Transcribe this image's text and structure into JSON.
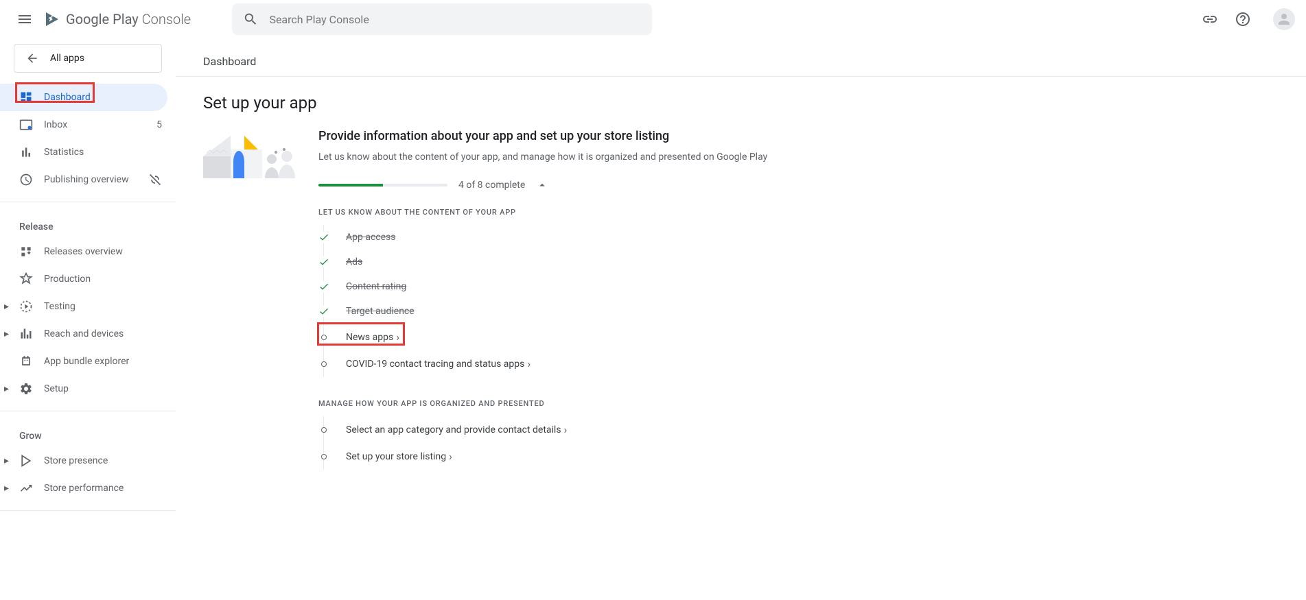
{
  "header": {
    "logo_play": "Google Play",
    "logo_console": " Console",
    "search_placeholder": "Search Play Console"
  },
  "sidebar": {
    "all_apps": "All apps",
    "items_top": [
      {
        "label": "Dashboard",
        "active": true
      },
      {
        "label": "Inbox",
        "badge": "5"
      },
      {
        "label": "Statistics"
      },
      {
        "label": "Publishing overview"
      }
    ],
    "section_release": "Release",
    "items_release": [
      {
        "label": "Releases overview"
      },
      {
        "label": "Production"
      },
      {
        "label": "Testing",
        "expandable": true
      },
      {
        "label": "Reach and devices",
        "expandable": true
      },
      {
        "label": "App bundle explorer"
      },
      {
        "label": "Setup",
        "expandable": true
      }
    ],
    "section_grow": "Grow",
    "items_grow": [
      {
        "label": "Store presence",
        "expandable": true
      },
      {
        "label": "Store performance",
        "expandable": true
      }
    ]
  },
  "main": {
    "breadcrumb": "Dashboard",
    "heading": "Set up your app",
    "setup_title": "Provide information about your app and set up your store listing",
    "setup_desc": "Let us know about the content of your app, and manage how it is organized and presented on Google Play",
    "progress_text": "4 of 8 complete",
    "section1_header": "LET US KNOW ABOUT THE CONTENT OF YOUR APP",
    "tasks1": [
      {
        "label": "App access",
        "done": true
      },
      {
        "label": "Ads",
        "done": true
      },
      {
        "label": "Content rating",
        "done": true
      },
      {
        "label": "Target audience",
        "done": true
      },
      {
        "label": "News apps",
        "done": false,
        "highlight": true
      },
      {
        "label": "COVID-19 contact tracing and status apps",
        "done": false
      }
    ],
    "section2_header": "MANAGE HOW YOUR APP IS ORGANIZED AND PRESENTED",
    "tasks2": [
      {
        "label": "Select an app category and provide contact details",
        "done": false
      },
      {
        "label": "Set up your store listing",
        "done": false
      }
    ]
  }
}
